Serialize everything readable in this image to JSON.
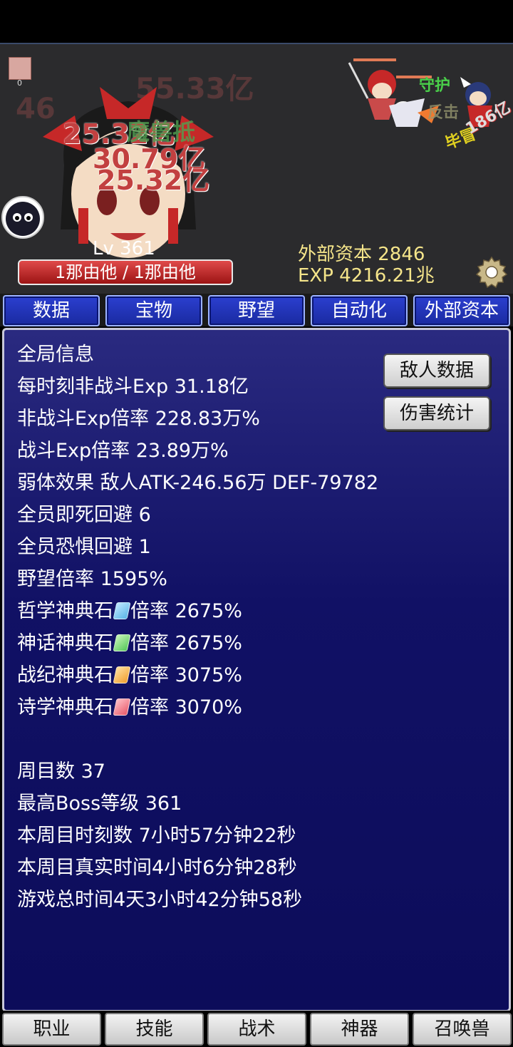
{
  "battle": {
    "enemy_count": "0",
    "ghost_damage": [
      "55.33亿",
      "46"
    ],
    "damage_numbers": [
      "25.32亿",
      "30.79亿",
      "25.32亿"
    ],
    "status_tag": "魔兽抵",
    "hero_texts": [
      "守护",
      "反击",
      "毕冒",
      "186亿"
    ],
    "level": "Lv 361",
    "hp": "1那由他 / 1那由他",
    "capital": "外部资本 2846",
    "exp": "EXP 4216.21兆"
  },
  "top_tabs": [
    "数据",
    "宝物",
    "野望",
    "自动化",
    "外部资本"
  ],
  "panel": {
    "lines": [
      "全局信息",
      "每时刻非战斗Exp 31.18亿",
      "非战斗Exp倍率 228.83万%",
      "战斗Exp倍率 23.89万%",
      "弱体效果 敌人ATK-246.56万 DEF-79782",
      "全员即死回避 6",
      "全员恐惧回避 1",
      "野望倍率 1595%"
    ],
    "stones": [
      {
        "name": "哲学神典石",
        "rate": "倍率 2675%",
        "color": "#5ab4e6"
      },
      {
        "name": "神话神典石",
        "rate": "倍率 2675%",
        "color": "#55c85a"
      },
      {
        "name": "战纪神典石",
        "rate": "倍率 3075%",
        "color": "#f0a030"
      },
      {
        "name": "诗学神典石",
        "rate": "倍率 3070%",
        "color": "#e85a6a"
      }
    ],
    "lines2": [
      "周目数 37",
      "最高Boss等级 361",
      "本周目时刻数 7小时57分钟22秒",
      "本周目真实时间4小时6分钟28秒",
      "游戏总时间4天3小时42分钟58秒"
    ],
    "enemy_data_button": "敌人数据",
    "damage_stats_button": "伤害统计"
  },
  "bottom_tabs": [
    "职业",
    "技能",
    "战术",
    "神器",
    "召唤兽"
  ]
}
